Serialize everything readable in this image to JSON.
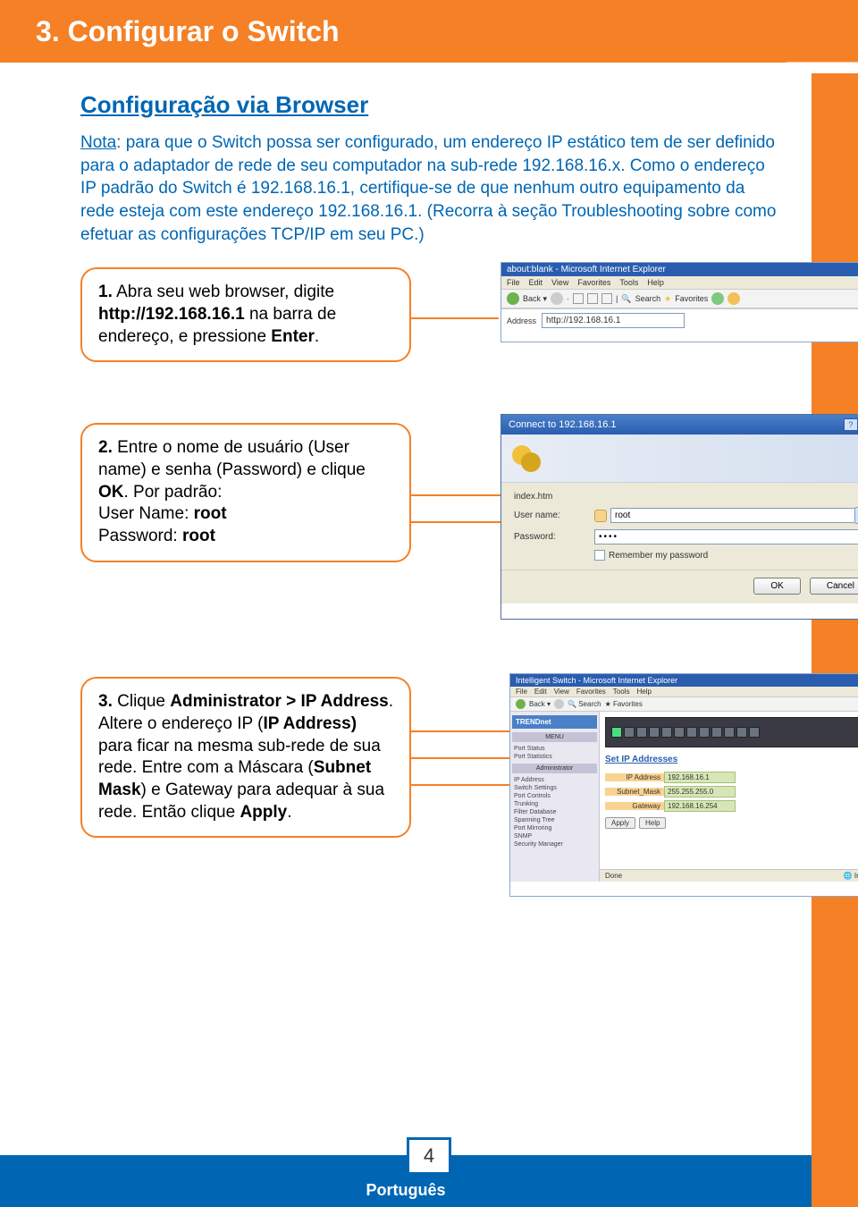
{
  "heading": "3. Configurar o Switch",
  "subheading": "Configuração via Browser",
  "nota_label": "Nota",
  "nota_text": ": para que o Switch possa ser configurado, um endereço IP estático tem de ser definido para o adaptador de rede de seu computador na sub-rede 192.168.16.x. Como o endereço IP padrão do Switch é 192.168.16.1, certifique-se de que nenhum outro equipamento da rede esteja com este endereço 192.168.16.1. (Recorra à seção Troubleshooting sobre como efetuar as configurações TCP/IP em seu PC.)",
  "steps": {
    "s1_num": "1.",
    "s1_a": " Abra seu web browser, digite ",
    "s1_url": "http://192.168.16.1",
    "s1_b": " na barra de endereço, e pressione ",
    "s1_enter": "Enter",
    "s1_c": ".",
    "s2_num": "2.",
    "s2_a": " Entre o nome de usuário (User name) e senha (Password) e clique ",
    "s2_ok": "OK",
    "s2_b": ". Por padrão:",
    "s2_user_lbl": "User Name: ",
    "s2_user_val": "root",
    "s2_pass_lbl": "Password: ",
    "s2_pass_val": "root",
    "s3_num": "3.",
    "s3_a": " Clique ",
    "s3_admin": "Administrator > IP Address",
    "s3_b": ". Altere o endereço IP (",
    "s3_ip": "IP Address)",
    "s3_c": " para ficar na mesma sub-rede de sua rede. Entre com a Máscara (",
    "s3_mask": "Subnet Mask",
    "s3_d": ") e Gateway para adequar à sua rede. Então clique ",
    "s3_apply": "Apply",
    "s3_e": "."
  },
  "shot1": {
    "title": "about:blank - Microsoft Internet Explorer",
    "menu": [
      "File",
      "Edit",
      "View",
      "Favorites",
      "Tools",
      "Help"
    ],
    "search": "Search",
    "favorites": "Favorites",
    "addr_label": "Address",
    "addr_value": "http://192.168.16.1"
  },
  "shot2": {
    "title": "Connect to 192.168.16.1",
    "file": "index.htm",
    "user_label": "User name:",
    "user_value": "root",
    "pass_label": "Password:",
    "pass_value": "••••",
    "remember": "Remember my password",
    "ok": "OK",
    "cancel": "Cancel"
  },
  "shot3": {
    "title": "Intelligent Switch - Microsoft Internet Explorer",
    "menu": [
      "File",
      "Edit",
      "View",
      "Favorites",
      "Tools",
      "Help"
    ],
    "brand": "TRENDnet",
    "menu_cat": "MENU",
    "side_admin": "Administrator",
    "side_items1": [
      "Port Status",
      "Port Statistics"
    ],
    "side_items2": [
      "IP Address",
      "Switch Settings"
    ],
    "side_items3": [
      "Port Controls",
      "Trunking",
      "Filter Database"
    ],
    "side_items4": [
      "Spanning Tree",
      "Port Mirroring",
      "SNMP",
      "Security Manager"
    ],
    "panel_title": "Set IP Addresses",
    "ip_lbl": "IP Address",
    "ip_val": "192.168.16.1",
    "mask_lbl": "Subnet_Mask",
    "mask_val": "255.255.255.0",
    "gw_lbl": "Gateway",
    "gw_val": "192.168.16.254",
    "apply": "Apply",
    "help": "Help",
    "done": "Done",
    "internet": "Internet"
  },
  "page_number": "4",
  "footer_label": "Português"
}
